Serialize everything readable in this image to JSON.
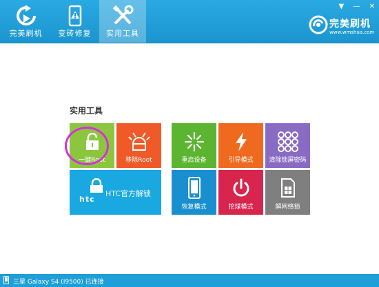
{
  "tabs": [
    {
      "label": "完美刷机",
      "icon": "refresh-arrow-icon"
    },
    {
      "label": "变砖修复",
      "icon": "phone-warning-icon"
    },
    {
      "label": "实用工具",
      "icon": "tools-icon",
      "active": true
    }
  ],
  "brand": {
    "name": "完美刷机",
    "url": "www.wmshua.com"
  },
  "section_title": "实用工具",
  "tiles": {
    "root": {
      "label": "一键Root",
      "color": "#8cc63f",
      "icon": "unlock-icon"
    },
    "remove_root": {
      "label": "移除Root",
      "color": "#f05a28",
      "icon": "android-remove-icon"
    },
    "reboot": {
      "label": "重启设备",
      "color": "#5cb531",
      "icon": "burst-icon"
    },
    "bootloader": {
      "label": "引导模式",
      "color": "#ef6a1f",
      "icon": "lightning-icon"
    },
    "clear_lock": {
      "label": "清除锁屏密码",
      "color": "#8a6bc4",
      "icon": "pattern-lock-icon"
    },
    "htc": {
      "label": "HTC官方解锁",
      "logo": "htc",
      "color": "#19a8e0",
      "icon": "lock-icon"
    },
    "recovery": {
      "label": "恢复模式",
      "color": "#1a8fd0",
      "icon": "phone-icon"
    },
    "dig": {
      "label": "挖煤模式",
      "color": "#d8254e",
      "icon": "power-icon"
    },
    "unlock_net": {
      "label": "解网络锁",
      "color": "#7f7f7f",
      "icon": "sim-card-icon"
    }
  },
  "status": {
    "text": "三星 Galaxy S4 (I9500) 已连接"
  }
}
